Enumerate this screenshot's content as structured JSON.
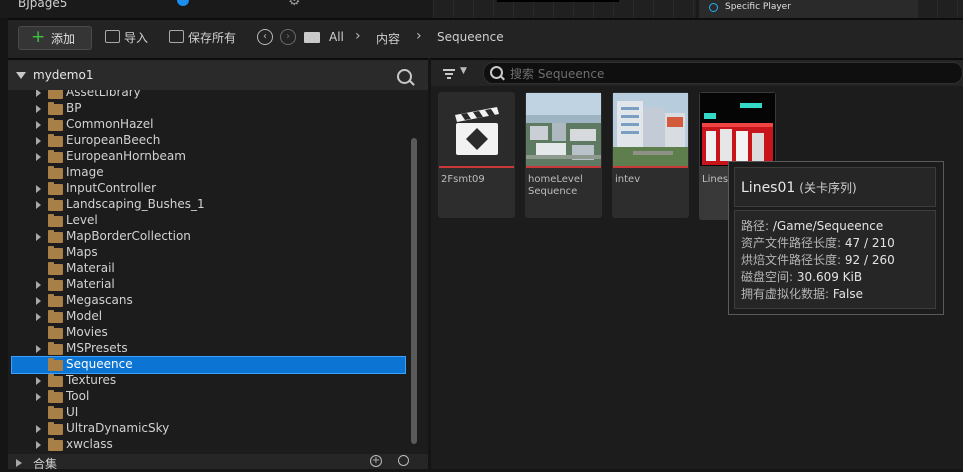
{
  "top": {
    "tab_label": "BJpage5",
    "specific_player": "Specific Player"
  },
  "toolbar": {
    "add_label": "添加",
    "import_label": "导入",
    "save_all_label": "保存所有",
    "breadcrumb": [
      "All",
      "内容",
      "Sequeence"
    ]
  },
  "sources": {
    "root_label": "mydemo1",
    "tree": [
      {
        "label": "AssetLibrary",
        "expandable": true
      },
      {
        "label": "BP",
        "expandable": true
      },
      {
        "label": "CommonHazel",
        "expandable": true
      },
      {
        "label": "EuropeanBeech",
        "expandable": true
      },
      {
        "label": "EuropeanHornbeam",
        "expandable": true
      },
      {
        "label": "Image",
        "expandable": false
      },
      {
        "label": "InputController",
        "expandable": true
      },
      {
        "label": "Landscaping_Bushes_1",
        "expandable": true
      },
      {
        "label": "Level",
        "expandable": false
      },
      {
        "label": "MapBorderCollection",
        "expandable": true
      },
      {
        "label": "Maps",
        "expandable": false
      },
      {
        "label": "Materail",
        "expandable": false
      },
      {
        "label": "Material",
        "expandable": true
      },
      {
        "label": "Megascans",
        "expandable": true
      },
      {
        "label": "Model",
        "expandable": true
      },
      {
        "label": "Movies",
        "expandable": false
      },
      {
        "label": "MSPresets",
        "expandable": true
      },
      {
        "label": "Sequeence",
        "expandable": false,
        "selected": true
      },
      {
        "label": "Textures",
        "expandable": true
      },
      {
        "label": "Tool",
        "expandable": true
      },
      {
        "label": "UI",
        "expandable": false
      },
      {
        "label": "UltraDynamicSky",
        "expandable": true
      },
      {
        "label": "xwclass",
        "expandable": true
      }
    ],
    "collections_label": "合集"
  },
  "content": {
    "search_placeholder": "搜索 Sequeence",
    "assets": [
      {
        "name": "2Fsmt09",
        "thumb": "clapperboard-icon"
      },
      {
        "name": "homeLevel Sequence",
        "thumb": "aerial-city-photo"
      },
      {
        "name": "intev",
        "thumb": "building-photo"
      },
      {
        "name": "Lines01",
        "thumb": "red-rig-render"
      }
    ]
  },
  "tooltip": {
    "title": "Lines01",
    "type": "(关卡序列)",
    "rows": [
      {
        "key": "路径:",
        "value": "/Game/Sequeence"
      },
      {
        "key": "资产文件路径长度:",
        "value": "47 / 210"
      },
      {
        "key": "烘焙文件路径长度:",
        "value": "92 / 260"
      },
      {
        "key": "磁盘空间:",
        "value": "30.609 KiB"
      },
      {
        "key": "拥有虚拟化数据:",
        "value": "False"
      }
    ]
  },
  "colors": {
    "selection": "#0c74d3",
    "folder": "#a77f47",
    "add_plus": "#3fc43f",
    "asset_strip": "#c83a3a"
  }
}
